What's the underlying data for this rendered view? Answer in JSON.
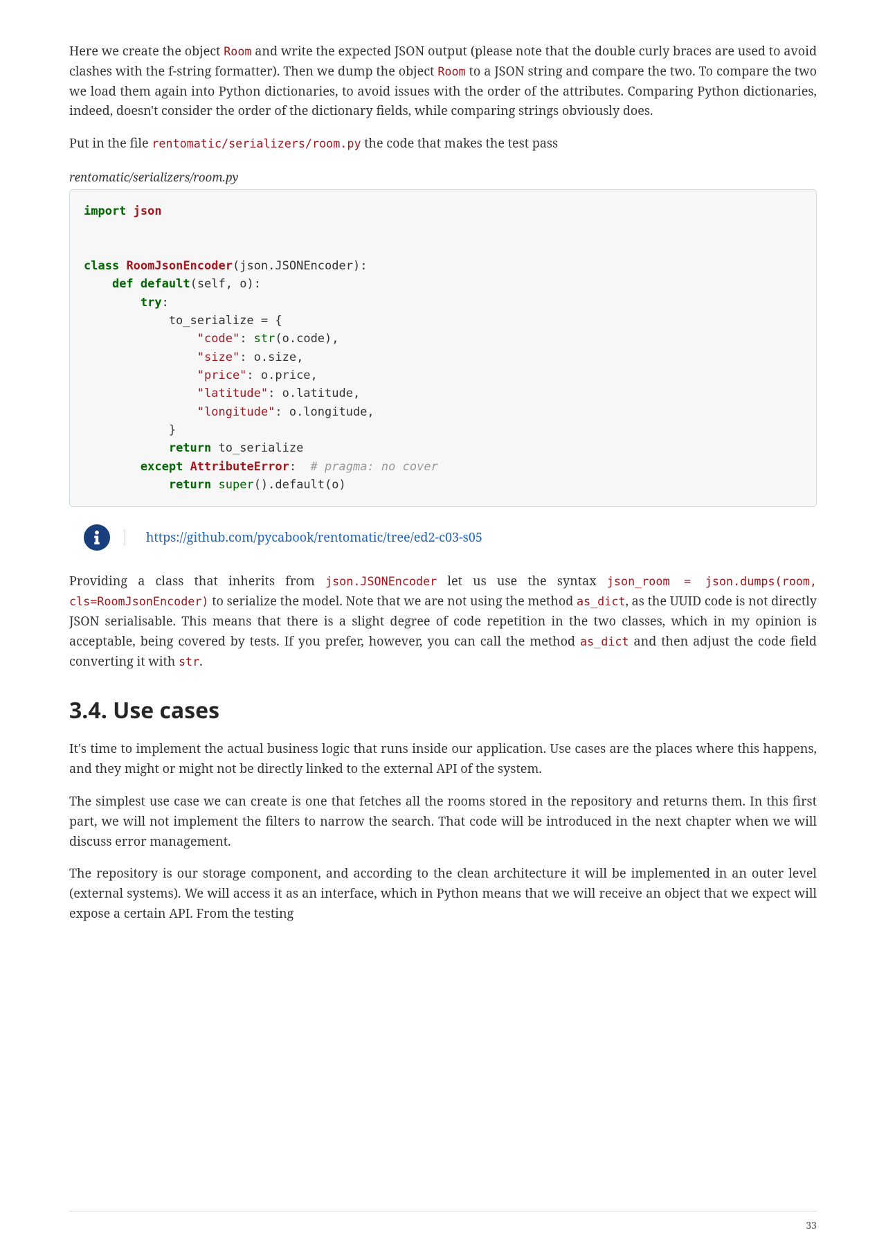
{
  "para1": {
    "t1": "Here we create the object ",
    "c1": "Room",
    "t2": " and write the expected JSON output (please note that the double curly braces are used to avoid clashes with the f-string formatter). Then we dump the object ",
    "c2": "Room",
    "t3": " to a JSON string and compare the two. To compare the two we load them again into Python dictionaries, to avoid issues with the order of the attributes. Comparing Python dictionaries, indeed, doesn't consider the order of the dictionary fields, while comparing strings obviously does."
  },
  "para2": {
    "t1": "Put in the file ",
    "c1": "rentomatic/serializers/room.py",
    "t2": " the code that makes the test pass"
  },
  "code_title": "rentomatic/serializers/room.py",
  "code": {
    "l1_kw1": "import",
    "l1_mod": "json",
    "l2_kw1": "class",
    "l2_cls": "RoomJsonEncoder",
    "l2_rest": "(json.JSONEncoder):",
    "l3_kw1": "def",
    "l3_fn": "default",
    "l3_rest": "(self, o):",
    "l4_kw1": "try",
    "l4_rest": ":",
    "l5": "            to_serialize = {",
    "l6_str": "\"code\"",
    "l6_rest1": ": ",
    "l6_fn": "str",
    "l6_rest2": "(o.code),",
    "l7_str": "\"size\"",
    "l7_rest": ": o.size,",
    "l8_str": "\"price\"",
    "l8_rest": ": o.price,",
    "l9_str": "\"latitude\"",
    "l9_rest": ": o.latitude,",
    "l10_str": "\"longitude\"",
    "l10_rest": ": o.longitude,",
    "l11": "            }",
    "l12_kw": "return",
    "l12_rest": " to_serialize",
    "l13_kw": "except",
    "l13_cls": "AttributeError",
    "l13_rest": ":  ",
    "l13_com": "# pragma: no cover",
    "l14_kw": "return",
    "l14_fn": "super",
    "l14_rest": "().default(o)"
  },
  "admonition_link": "https://github.com/pycabook/rentomatic/tree/ed2-c03-s05",
  "para3": {
    "t1": "Providing a class that inherits from ",
    "c1": "json.JSONEncoder",
    "t2": " let us use the syntax ",
    "c2": "json_room = json.dumps(room, cls=RoomJsonEncoder)",
    "t3": " to serialize the model. Note that we are not using the method ",
    "c3": "as_dict",
    "t4": ", as the UUID code is not directly JSON serialisable. This means that there is a slight degree of code repetition in the two classes, which in my opinion is acceptable, being covered by tests. If you prefer, however, you can call the method ",
    "c4": "as_dict",
    "t5": " and then adjust the code field converting it with ",
    "c5": "str",
    "t6": "."
  },
  "heading": "3.4. Use cases",
  "para4": "It's time to implement the actual business logic that runs inside our application. Use cases are the places where this happens, and they might or might not be directly linked to the external API of the system.",
  "para5": "The simplest use case we can create is one that fetches all the rooms stored in the repository and returns them. In this first part, we will not implement the filters to narrow the search. That code will be introduced in the next chapter when we will discuss error management.",
  "para6": "The repository is our storage component, and according to the clean architecture it will be implemented in an outer level (external systems). We will access it as an interface, which in Python means that we will receive an object that we expect will expose a certain API. From the testing",
  "page_number": "33"
}
